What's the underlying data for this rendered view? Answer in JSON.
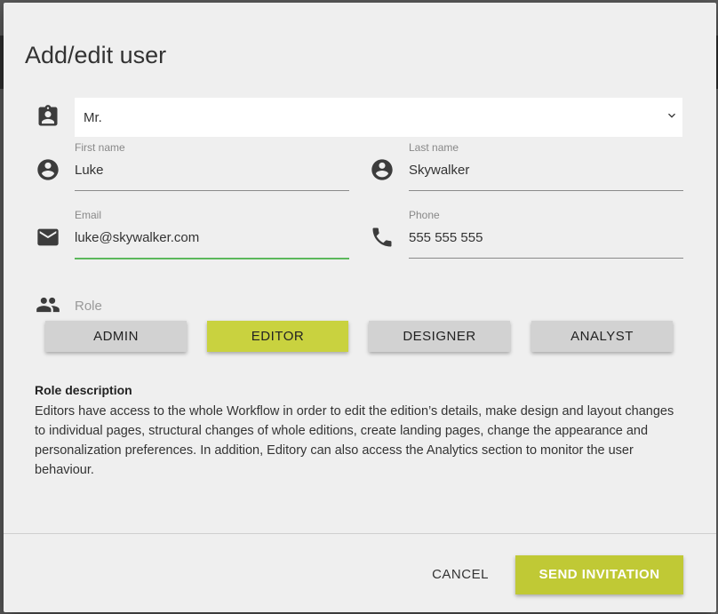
{
  "dialog": {
    "title": "Add/edit user"
  },
  "form": {
    "salutation": {
      "value": "Mr.",
      "icon": "assignment-ind-icon"
    },
    "first_name": {
      "label": "First name",
      "value": "Luke",
      "icon": "account-circle-icon"
    },
    "last_name": {
      "label": "Last name",
      "value": "Skywalker",
      "icon": "account-circle-icon"
    },
    "email": {
      "label": "Email",
      "value": "luke@skywalker.com",
      "icon": "mail-icon"
    },
    "phone": {
      "label": "Phone",
      "value": "555 555 555",
      "icon": "phone-icon"
    },
    "role": {
      "label": "Role",
      "icon": "people-icon",
      "options": [
        "ADMIN",
        "EDITOR",
        "DESIGNER",
        "ANALYST"
      ],
      "selected": "EDITOR"
    }
  },
  "role_description": {
    "title": "Role description",
    "text": "Editors have access to the whole Workflow in order to edit the edition’s details, make design and layout changes to individual pages, structural changes of whole editions, create landing pages, change the appearance and personalization preferences. In addition, Editory can also access the Analytics section to monitor the user behaviour."
  },
  "actions": {
    "cancel_label": "CANCEL",
    "send_label": "SEND INVITATION"
  },
  "colors": {
    "accent": "#c0c935",
    "role_selected": "#c9d23f",
    "role_default": "#d2d2d2",
    "active_underline": "#5cb85c"
  }
}
